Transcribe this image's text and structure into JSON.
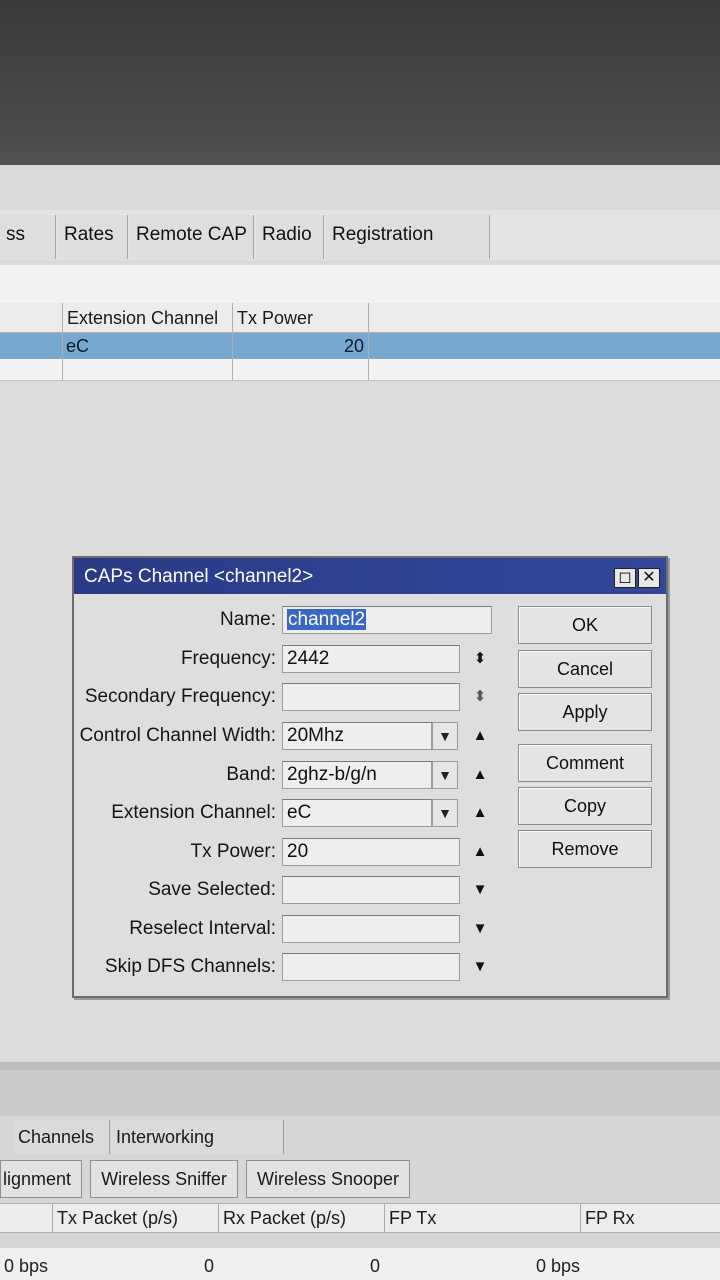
{
  "tabs": [
    "ss List",
    "Rates",
    "Remote CAP",
    "Radio",
    "Registration Table"
  ],
  "table": {
    "headers": [
      "Extension Channel",
      "Tx Power"
    ],
    "row": {
      "extension_channel": "eC",
      "tx_power": "20"
    }
  },
  "dialog": {
    "title": "CAPs Channel <channel2>",
    "fields": {
      "name": {
        "label": "Name:",
        "value": "channel2"
      },
      "frequency": {
        "label": "Frequency:",
        "value": "2442"
      },
      "secondary_frequency": {
        "label": "Secondary Frequency:",
        "value": ""
      },
      "control_channel_width": {
        "label": "Control Channel Width:",
        "value": "20Mhz"
      },
      "band": {
        "label": "Band:",
        "value": "2ghz-b/g/n"
      },
      "extension_channel": {
        "label": "Extension Channel:",
        "value": "eC"
      },
      "tx_power": {
        "label": "Tx Power:",
        "value": "20"
      },
      "save_selected": {
        "label": "Save Selected:",
        "value": ""
      },
      "reselect_interval": {
        "label": "Reselect Interval:",
        "value": ""
      },
      "skip_dfs_channels": {
        "label": "Skip DFS Channels:",
        "value": ""
      }
    },
    "buttons": {
      "ok": "OK",
      "cancel": "Cancel",
      "apply": "Apply",
      "comment": "Comment",
      "copy": "Copy",
      "remove": "Remove"
    }
  },
  "bottom": {
    "tabs": [
      "Channels",
      "Interworking Profiles"
    ],
    "buttons": [
      "lignment",
      "Wireless Sniffer",
      "Wireless Snooper"
    ],
    "headers": [
      "Tx Packet (p/s)",
      "Rx Packet (p/s)",
      "FP Tx",
      "FP Rx"
    ],
    "row": [
      "0 bps",
      "0",
      "0",
      "0 bps"
    ]
  },
  "icons": {
    "updown": "up-down-arrows-icon",
    "dropdown": "dropdown-icon",
    "up": "up-arrow-icon",
    "down": "down-arrow-icon"
  }
}
